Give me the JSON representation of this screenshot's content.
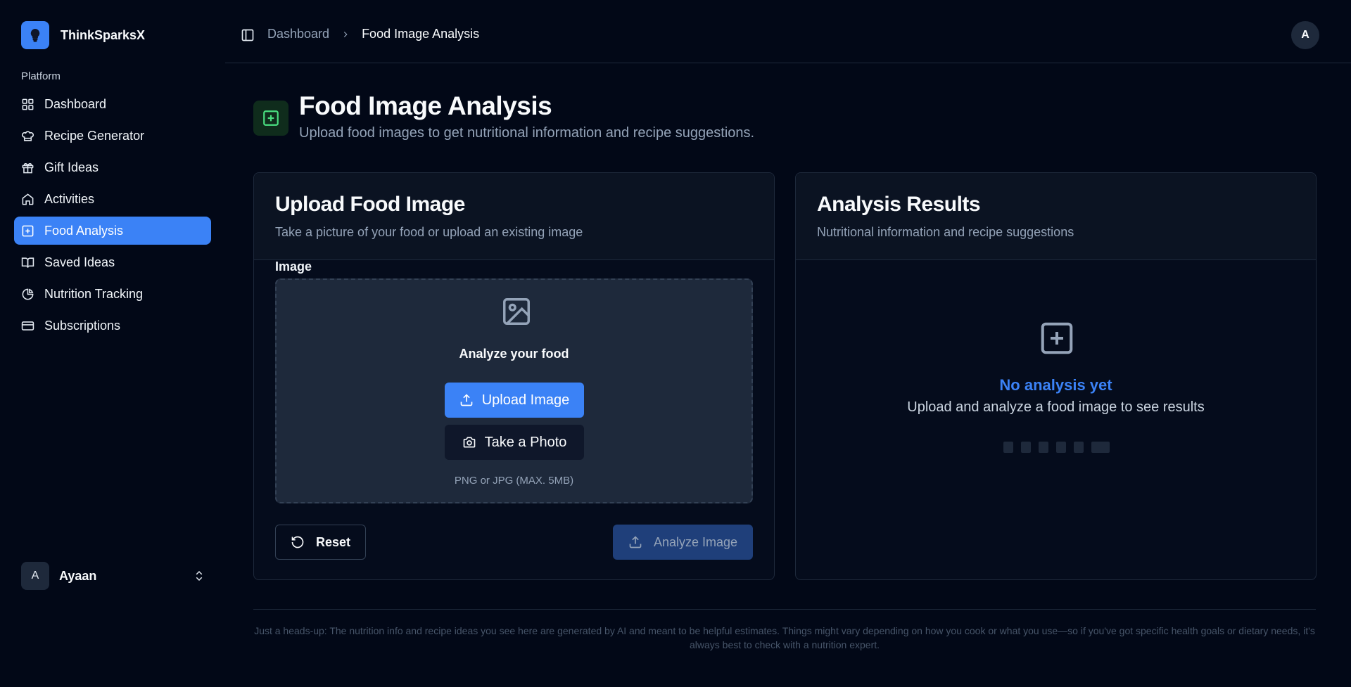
{
  "brand": {
    "name": "ThinkSparksX"
  },
  "sidebar": {
    "group_label": "Platform",
    "items": [
      {
        "label": "Dashboard",
        "icon": "grid-icon"
      },
      {
        "label": "Recipe Generator",
        "icon": "chef-hat-icon"
      },
      {
        "label": "Gift Ideas",
        "icon": "gift-icon"
      },
      {
        "label": "Activities",
        "icon": "home-icon"
      },
      {
        "label": "Food Analysis",
        "icon": "plus-square-icon",
        "active": true
      },
      {
        "label": "Saved Ideas",
        "icon": "book-open-icon"
      },
      {
        "label": "Nutrition Tracking",
        "icon": "pie-chart-icon"
      },
      {
        "label": "Subscriptions",
        "icon": "credit-card-icon"
      }
    ],
    "user": {
      "initial": "A",
      "name": "Ayaan"
    }
  },
  "header": {
    "breadcrumb": {
      "parent": "Dashboard",
      "current": "Food Image Analysis"
    },
    "avatar_initial": "A"
  },
  "page": {
    "title": "Food Image Analysis",
    "subtitle": "Upload food images to get nutritional information and recipe suggestions."
  },
  "upload_card": {
    "title": "Upload Food Image",
    "description": "Take a picture of your food or upload an existing image",
    "image_label": "Image",
    "dropzone_title": "Analyze your food",
    "upload_button": "Upload Image",
    "photo_button": "Take a Photo",
    "hint": "PNG or JPG (MAX. 5MB)",
    "reset_button": "Reset",
    "analyze_button": "Analyze Image"
  },
  "results_card": {
    "title": "Analysis Results",
    "description": "Nutritional information and recipe suggestions",
    "empty_title": "No analysis yet",
    "empty_desc": "Upload and analyze a food image to see results"
  },
  "footer": {
    "disclaimer": "Just a heads-up: The nutrition info and recipe ideas you see here are generated by AI and meant to be helpful estimates. Things might vary depending on how you cook or what you use—so if you've got specific health goals or dietary needs, it's always best to check with a nutrition expert."
  },
  "colors": {
    "accent": "#3b82f6",
    "background": "#020817",
    "success": "#4ade80"
  }
}
